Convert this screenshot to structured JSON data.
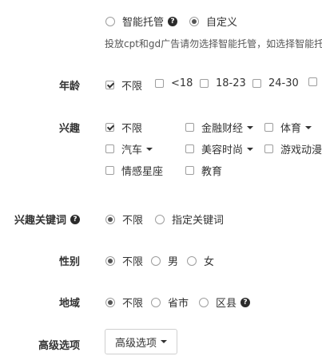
{
  "placement": {
    "options": [
      {
        "label": "智能托管",
        "checked": false,
        "help_icon": "help-icon"
      },
      {
        "label": "自定义",
        "checked": true
      }
    ],
    "hint": "投放cpt和gd广告请勿选择智能托管，如选择智能托"
  },
  "age": {
    "label": "年龄",
    "options": [
      {
        "label": "不限",
        "checked": true
      },
      {
        "label": "<18",
        "checked": false
      },
      {
        "label": "18-23",
        "checked": false
      },
      {
        "label": "24-30",
        "checked": false
      }
    ]
  },
  "interest": {
    "label": "兴趣",
    "options": [
      {
        "label": "不限",
        "checked": true
      },
      {
        "label": "金融财经",
        "checked": false,
        "dropdown": true
      },
      {
        "label": "体育",
        "checked": false,
        "dropdown": true
      },
      {
        "label": "汽车",
        "checked": false,
        "dropdown": true
      },
      {
        "label": "美容时尚",
        "checked": false,
        "dropdown": true
      },
      {
        "label": "游戏动漫",
        "checked": false
      },
      {
        "label": "情感星座",
        "checked": false
      },
      {
        "label": "教育",
        "checked": false
      }
    ]
  },
  "interest_keywords": {
    "label": "兴趣关键词",
    "options": [
      {
        "label": "不限",
        "checked": true
      },
      {
        "label": "指定关键词",
        "checked": false
      }
    ]
  },
  "gender": {
    "label": "性别",
    "options": [
      {
        "label": "不限",
        "checked": true
      },
      {
        "label": "男",
        "checked": false
      },
      {
        "label": "女",
        "checked": false
      }
    ]
  },
  "region": {
    "label": "地域",
    "options": [
      {
        "label": "不限",
        "checked": true
      },
      {
        "label": "省市",
        "checked": false
      },
      {
        "label": "区县",
        "checked": false
      }
    ]
  },
  "advanced": {
    "label": "高级选项",
    "button_label": "高级选项"
  },
  "colors": {
    "text": "#333333",
    "border": "#9e9e9e",
    "help_icon_bg": "#2b2b2b"
  }
}
